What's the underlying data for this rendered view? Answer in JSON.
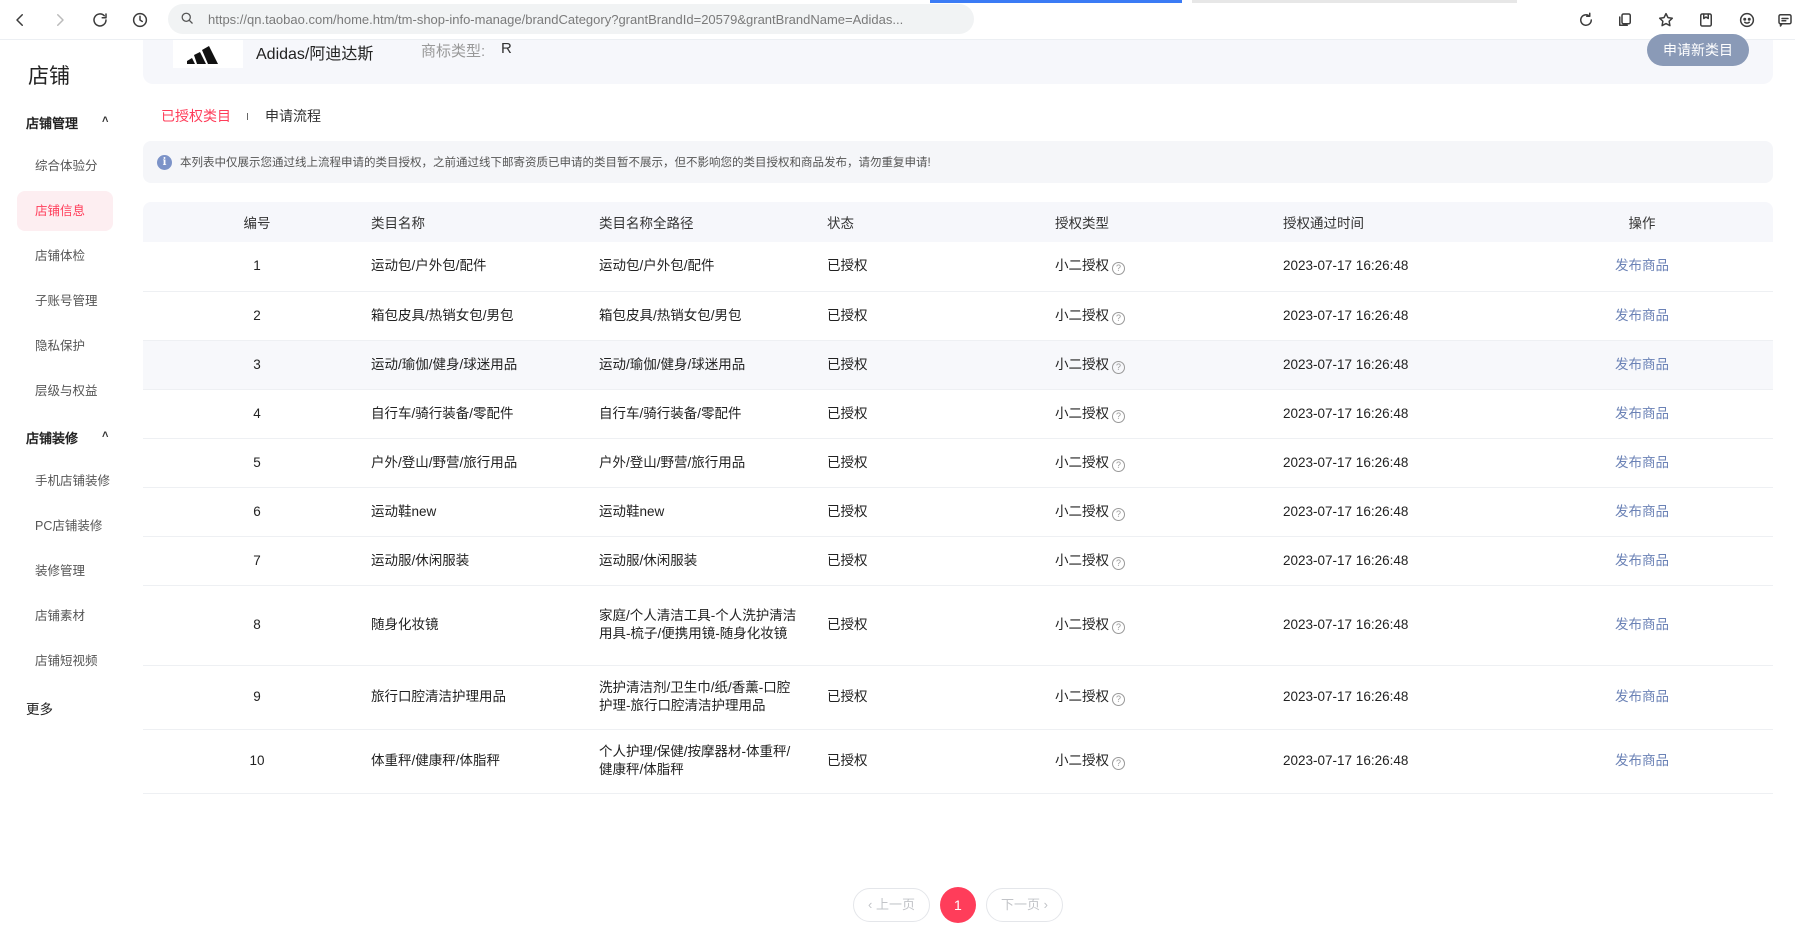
{
  "browser": {
    "url": "https://qn.taobao.com/home.htm/tm-shop-info-manage/brandCategory?grantBrandId=20579&grantBrandName=Adidas..."
  },
  "sidebar": {
    "title": "店铺",
    "groups": [
      {
        "label": "店铺管理",
        "items": [
          "综合体验分",
          "店铺信息",
          "店铺体检",
          "子账号管理",
          "隐私保护",
          "层级与权益"
        ]
      },
      {
        "label": "店铺装修",
        "items": [
          "手机店铺装修",
          "PC店铺装修",
          "装修管理",
          "店铺素材",
          "店铺短视频"
        ]
      }
    ],
    "more": "更多"
  },
  "brand": {
    "name": "Adidas/阿迪达斯",
    "type_label": "商标类型:",
    "type_value": "R",
    "apply_button": "申请新类目"
  },
  "tabs": [
    "已授权类目",
    "申请流程"
  ],
  "notice": "本列表中仅展示您通过线上流程申请的类目授权，之前通过线下邮寄资质已申请的类目暂不展示，但不影响您的类目授权和商品发布，请勿重复申请!",
  "table": {
    "headers": [
      "编号",
      "类目名称",
      "类目名称全路径",
      "状态",
      "授权类型",
      "授权通过时间",
      "操作"
    ],
    "rows": [
      {
        "no": "1",
        "name": "运动包/户外包/配件",
        "path": "运动包/户外包/配件",
        "status": "已授权",
        "type": "小二授权",
        "time": "2023-07-17 16:26:48",
        "op": "发布商品"
      },
      {
        "no": "2",
        "name": "箱包皮具/热销女包/男包",
        "path": "箱包皮具/热销女包/男包",
        "status": "已授权",
        "type": "小二授权",
        "time": "2023-07-17 16:26:48",
        "op": "发布商品"
      },
      {
        "no": "3",
        "name": "运动/瑜伽/健身/球迷用品",
        "path": "运动/瑜伽/健身/球迷用品",
        "status": "已授权",
        "type": "小二授权",
        "time": "2023-07-17 16:26:48",
        "op": "发布商品"
      },
      {
        "no": "4",
        "name": "自行车/骑行装备/零配件",
        "path": "自行车/骑行装备/零配件",
        "status": "已授权",
        "type": "小二授权",
        "time": "2023-07-17 16:26:48",
        "op": "发布商品"
      },
      {
        "no": "5",
        "name": "户外/登山/野营/旅行用品",
        "path": "户外/登山/野营/旅行用品",
        "status": "已授权",
        "type": "小二授权",
        "time": "2023-07-17 16:26:48",
        "op": "发布商品"
      },
      {
        "no": "6",
        "name": "运动鞋new",
        "path": "运动鞋new",
        "status": "已授权",
        "type": "小二授权",
        "time": "2023-07-17 16:26:48",
        "op": "发布商品"
      },
      {
        "no": "7",
        "name": "运动服/休闲服装",
        "path": "运动服/休闲服装",
        "status": "已授权",
        "type": "小二授权",
        "time": "2023-07-17 16:26:48",
        "op": "发布商品"
      },
      {
        "no": "8",
        "name": "随身化妆镜",
        "path": "家庭/个人清洁工具-个人洗护清洁用具-梳子/便携用镜-随身化妆镜",
        "status": "已授权",
        "type": "小二授权",
        "time": "2023-07-17 16:26:48",
        "op": "发布商品"
      },
      {
        "no": "9",
        "name": "旅行口腔清洁护理用品",
        "path": "洗护清洁剂/卫生巾/纸/香薰-口腔护理-旅行口腔清洁护理用品",
        "status": "已授权",
        "type": "小二授权",
        "time": "2023-07-17 16:26:48",
        "op": "发布商品"
      },
      {
        "no": "10",
        "name": "体重秤/健康秤/体脂秤",
        "path": "个人护理/保健/按摩器材-体重秤/健康秤/体脂秤",
        "status": "已授权",
        "type": "小二授权",
        "time": "2023-07-17 16:26:48",
        "op": "发布商品"
      }
    ]
  },
  "pager": {
    "prev": "‹ 上一页",
    "current": "1",
    "next": "下一页 ›"
  }
}
